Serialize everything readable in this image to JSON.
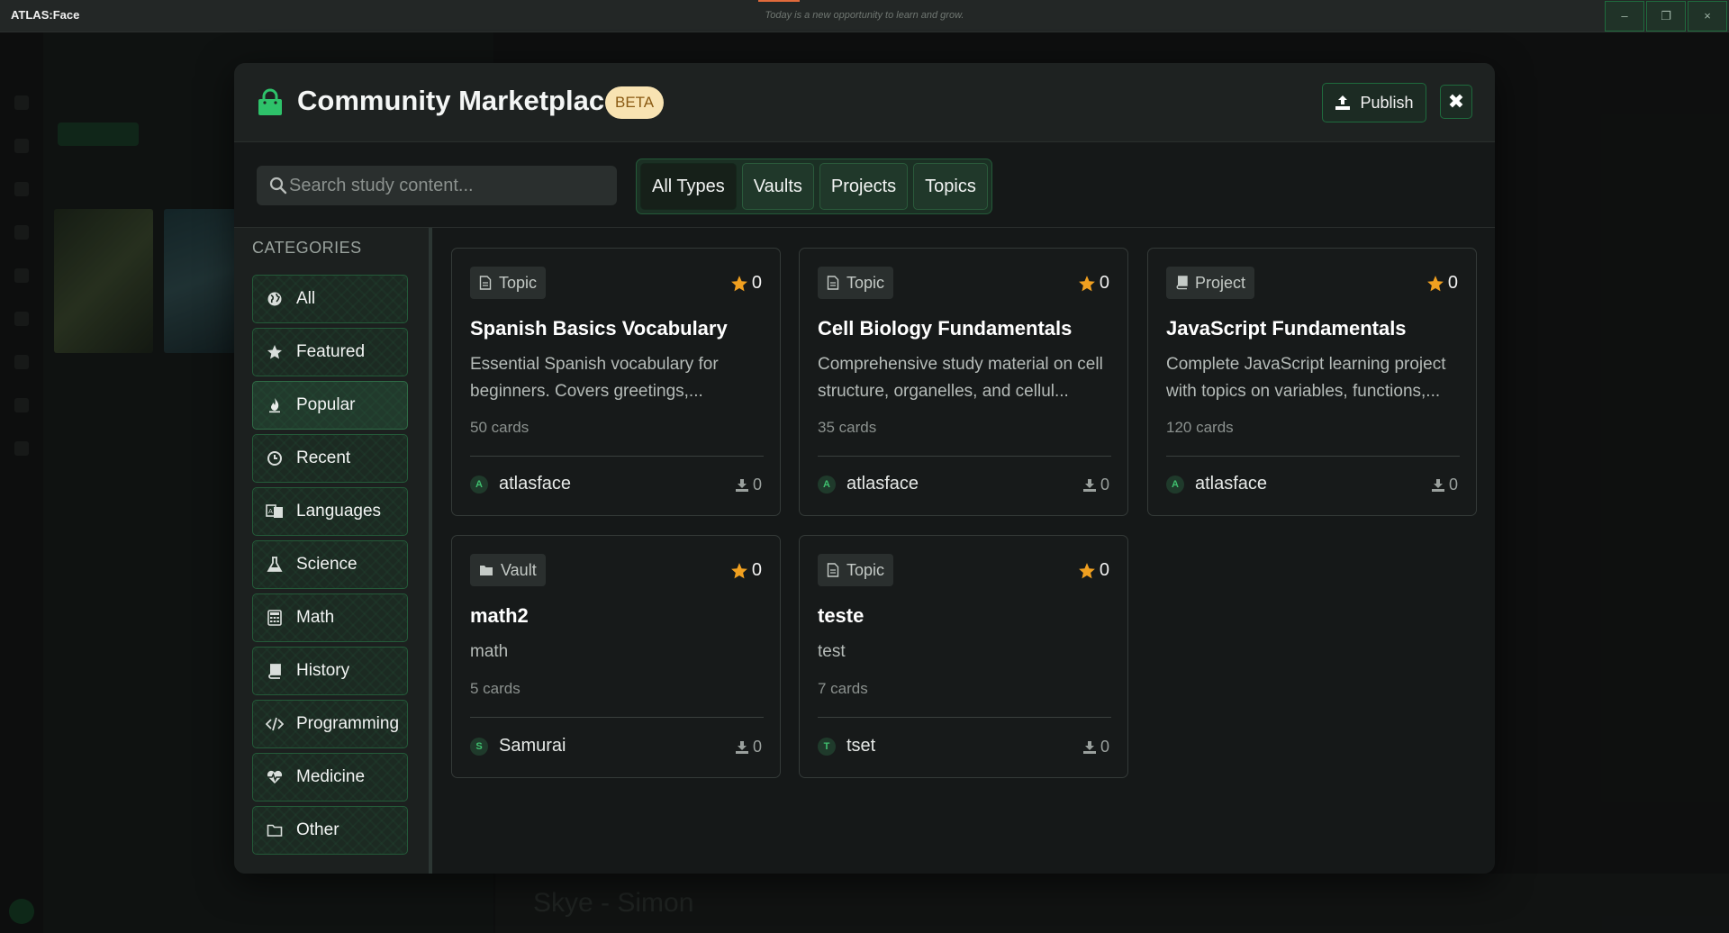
{
  "window": {
    "app_name": "ATLAS:Face",
    "tagline": "Today is a new opportunity to learn and grow.",
    "controls": [
      "–",
      "❐",
      "×"
    ]
  },
  "background": {
    "now_playing": "Skye - Simon"
  },
  "modal": {
    "title": "Community Marketplace",
    "badge": "BETA",
    "publish_label": "Publish",
    "close_label": "✖",
    "search_placeholder": "Search study content...",
    "type_filters": [
      {
        "label": "All Types",
        "active": true
      },
      {
        "label": "Vaults",
        "active": false
      },
      {
        "label": "Projects",
        "active": false
      },
      {
        "label": "Topics",
        "active": false
      }
    ],
    "categories_heading": "CATEGORIES",
    "categories": [
      {
        "label": "All",
        "icon": "globe-icon",
        "active": false
      },
      {
        "label": "Featured",
        "icon": "star-icon",
        "active": false
      },
      {
        "label": "Popular",
        "icon": "fire-icon",
        "active": true
      },
      {
        "label": "Recent",
        "icon": "clock-icon",
        "active": false
      },
      {
        "label": "Languages",
        "icon": "language-icon",
        "active": false
      },
      {
        "label": "Science",
        "icon": "flask-icon",
        "active": false
      },
      {
        "label": "Math",
        "icon": "calculator-icon",
        "active": false
      },
      {
        "label": "History",
        "icon": "book-icon",
        "active": false
      },
      {
        "label": "Programming",
        "icon": "code-icon",
        "active": false
      },
      {
        "label": "Medicine",
        "icon": "heartbeat-icon",
        "active": false
      },
      {
        "label": "Other",
        "icon": "folder-icon",
        "active": false
      }
    ],
    "cards": [
      {
        "type": "Topic",
        "type_icon": "document-icon",
        "rating": "0",
        "title": "Spanish Basics Vocabulary",
        "description": "Essential Spanish vocabulary for beginners. Covers greetings,...",
        "count": "50 cards",
        "author_initial": "A",
        "author": "atlasface",
        "downloads": "0"
      },
      {
        "type": "Topic",
        "type_icon": "document-icon",
        "rating": "0",
        "title": "Cell Biology Fundamentals",
        "description": "Comprehensive study material on cell structure, organelles, and cellul...",
        "count": "35 cards",
        "author_initial": "A",
        "author": "atlasface",
        "downloads": "0"
      },
      {
        "type": "Project",
        "type_icon": "book-icon",
        "rating": "0",
        "title": "JavaScript Fundamentals",
        "description": "Complete JavaScript learning project with topics on variables, functions,...",
        "count": "120 cards",
        "author_initial": "A",
        "author": "atlasface",
        "downloads": "0"
      },
      {
        "type": "Vault",
        "type_icon": "folder-icon",
        "rating": "0",
        "title": "math2",
        "description": "math",
        "count": "5 cards",
        "author_initial": "S",
        "author": "Samurai",
        "downloads": "0"
      },
      {
        "type": "Topic",
        "type_icon": "document-icon",
        "rating": "0",
        "title": "teste",
        "description": "test",
        "count": "7 cards",
        "author_initial": "T",
        "author": "tset",
        "downloads": "0"
      }
    ]
  },
  "colors": {
    "accent_green": "#1f6b3d",
    "bag_green": "#2ec26a",
    "star_orange": "#f0a020",
    "beta_bg": "#f8e3b2"
  }
}
